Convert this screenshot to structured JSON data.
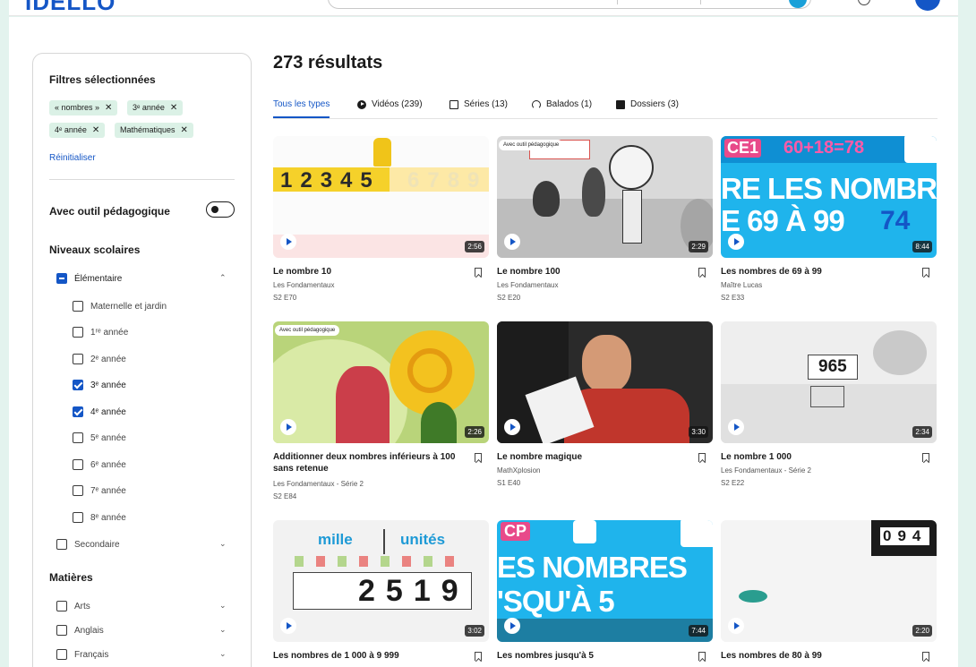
{
  "app": {
    "logo": "IDÉLLO"
  },
  "sidebar": {
    "selected_filters_title": "Filtres sélectionnées",
    "chips": [
      {
        "label": "« nombres »"
      },
      {
        "label": "3ᵉ année"
      },
      {
        "label": "4ᵉ année"
      },
      {
        "label": "Mathématiques"
      }
    ],
    "chip_remove": "✕",
    "reset_label": "Réinitialiser",
    "toggle_label": "Avec outil pédagogique",
    "levels_title": "Niveaux scolaires",
    "elementary_label": "Élémentaire",
    "levels": [
      {
        "label": "Maternelle et jardin",
        "checked": false
      },
      {
        "label": "1ʳᵉ année",
        "checked": false
      },
      {
        "label": "2ᵉ année",
        "checked": false
      },
      {
        "label": "3ᵉ année",
        "checked": true
      },
      {
        "label": "4ᵉ année",
        "checked": true
      },
      {
        "label": "5ᵉ année",
        "checked": false
      },
      {
        "label": "6ᵉ année",
        "checked": false
      },
      {
        "label": "7ᵉ année",
        "checked": false
      },
      {
        "label": "8ᵉ année",
        "checked": false
      }
    ],
    "secondary_label": "Secondaire",
    "subjects_title": "Matières",
    "subjects": [
      {
        "label": "Arts"
      },
      {
        "label": "Anglais"
      },
      {
        "label": "Français"
      }
    ]
  },
  "main": {
    "results_title": "273 résultats",
    "tabs": [
      {
        "label": "Tous les types"
      },
      {
        "label": "Vidéos (239)"
      },
      {
        "label": "Séries (13)"
      },
      {
        "label": "Balados (1)"
      },
      {
        "label": "Dossiers (3)"
      }
    ],
    "badge_label": "Avec outil pédagogique",
    "cards": [
      {
        "title": "Le nombre 10",
        "line1": "Les Fondamentaux",
        "line2": "S2 E70",
        "duration": "2:56",
        "thumb_text": "12345",
        "thumb_faded": "6789"
      },
      {
        "title": "Le nombre 100",
        "line1": "Les Fondamentaux",
        "line2": "S2 E20",
        "duration": "2:29"
      },
      {
        "title": "Les nombres de 69 à 99",
        "line1": "Maître Lucas",
        "line2": "S2 E33",
        "duration": "8:44",
        "thumb_text": "RE LES NOMBRES",
        "thumb_text2": "E 69 À 99",
        "thumb_eq": "60+18=78",
        "thumb_big": "74",
        "thumb_tag": "CE1"
      },
      {
        "title": "Additionner deux nombres inférieurs à 100 sans retenue",
        "line1": "Les Fondamentaux - Série 2",
        "line2": "S2 E84",
        "duration": "2:26"
      },
      {
        "title": "Le nombre magique",
        "line1": "MathXplosion",
        "line2": "S1 E40",
        "duration": "3:30"
      },
      {
        "title": "Le nombre 1 000",
        "line1": "Les Fondamentaux - Série 2",
        "line2": "S2 E22",
        "duration": "2:34",
        "thumb_text": "965"
      },
      {
        "title": "Les nombres de 1 000 à 9 999",
        "line1": "",
        "line2": "",
        "duration": "3:02",
        "thumb_mille": "mille",
        "thumb_unites": "unités",
        "thumb_digits": "2519"
      },
      {
        "title": "Les nombres jusqu'à 5",
        "line1": "",
        "line2": "",
        "duration": "7:44",
        "thumb_text": "ES NOMBRES",
        "thumb_text2": "'SQU'À 5",
        "thumb_tag": "CP"
      },
      {
        "title": "Les nombres de 80 à 99",
        "line1": "",
        "line2": "",
        "duration": "2:20",
        "thumb_text": "094"
      }
    ]
  },
  "colors": {
    "brand": "#1456c6",
    "accent_bg": "#e3f3ee",
    "chip_bg": "#dbf1e6"
  }
}
